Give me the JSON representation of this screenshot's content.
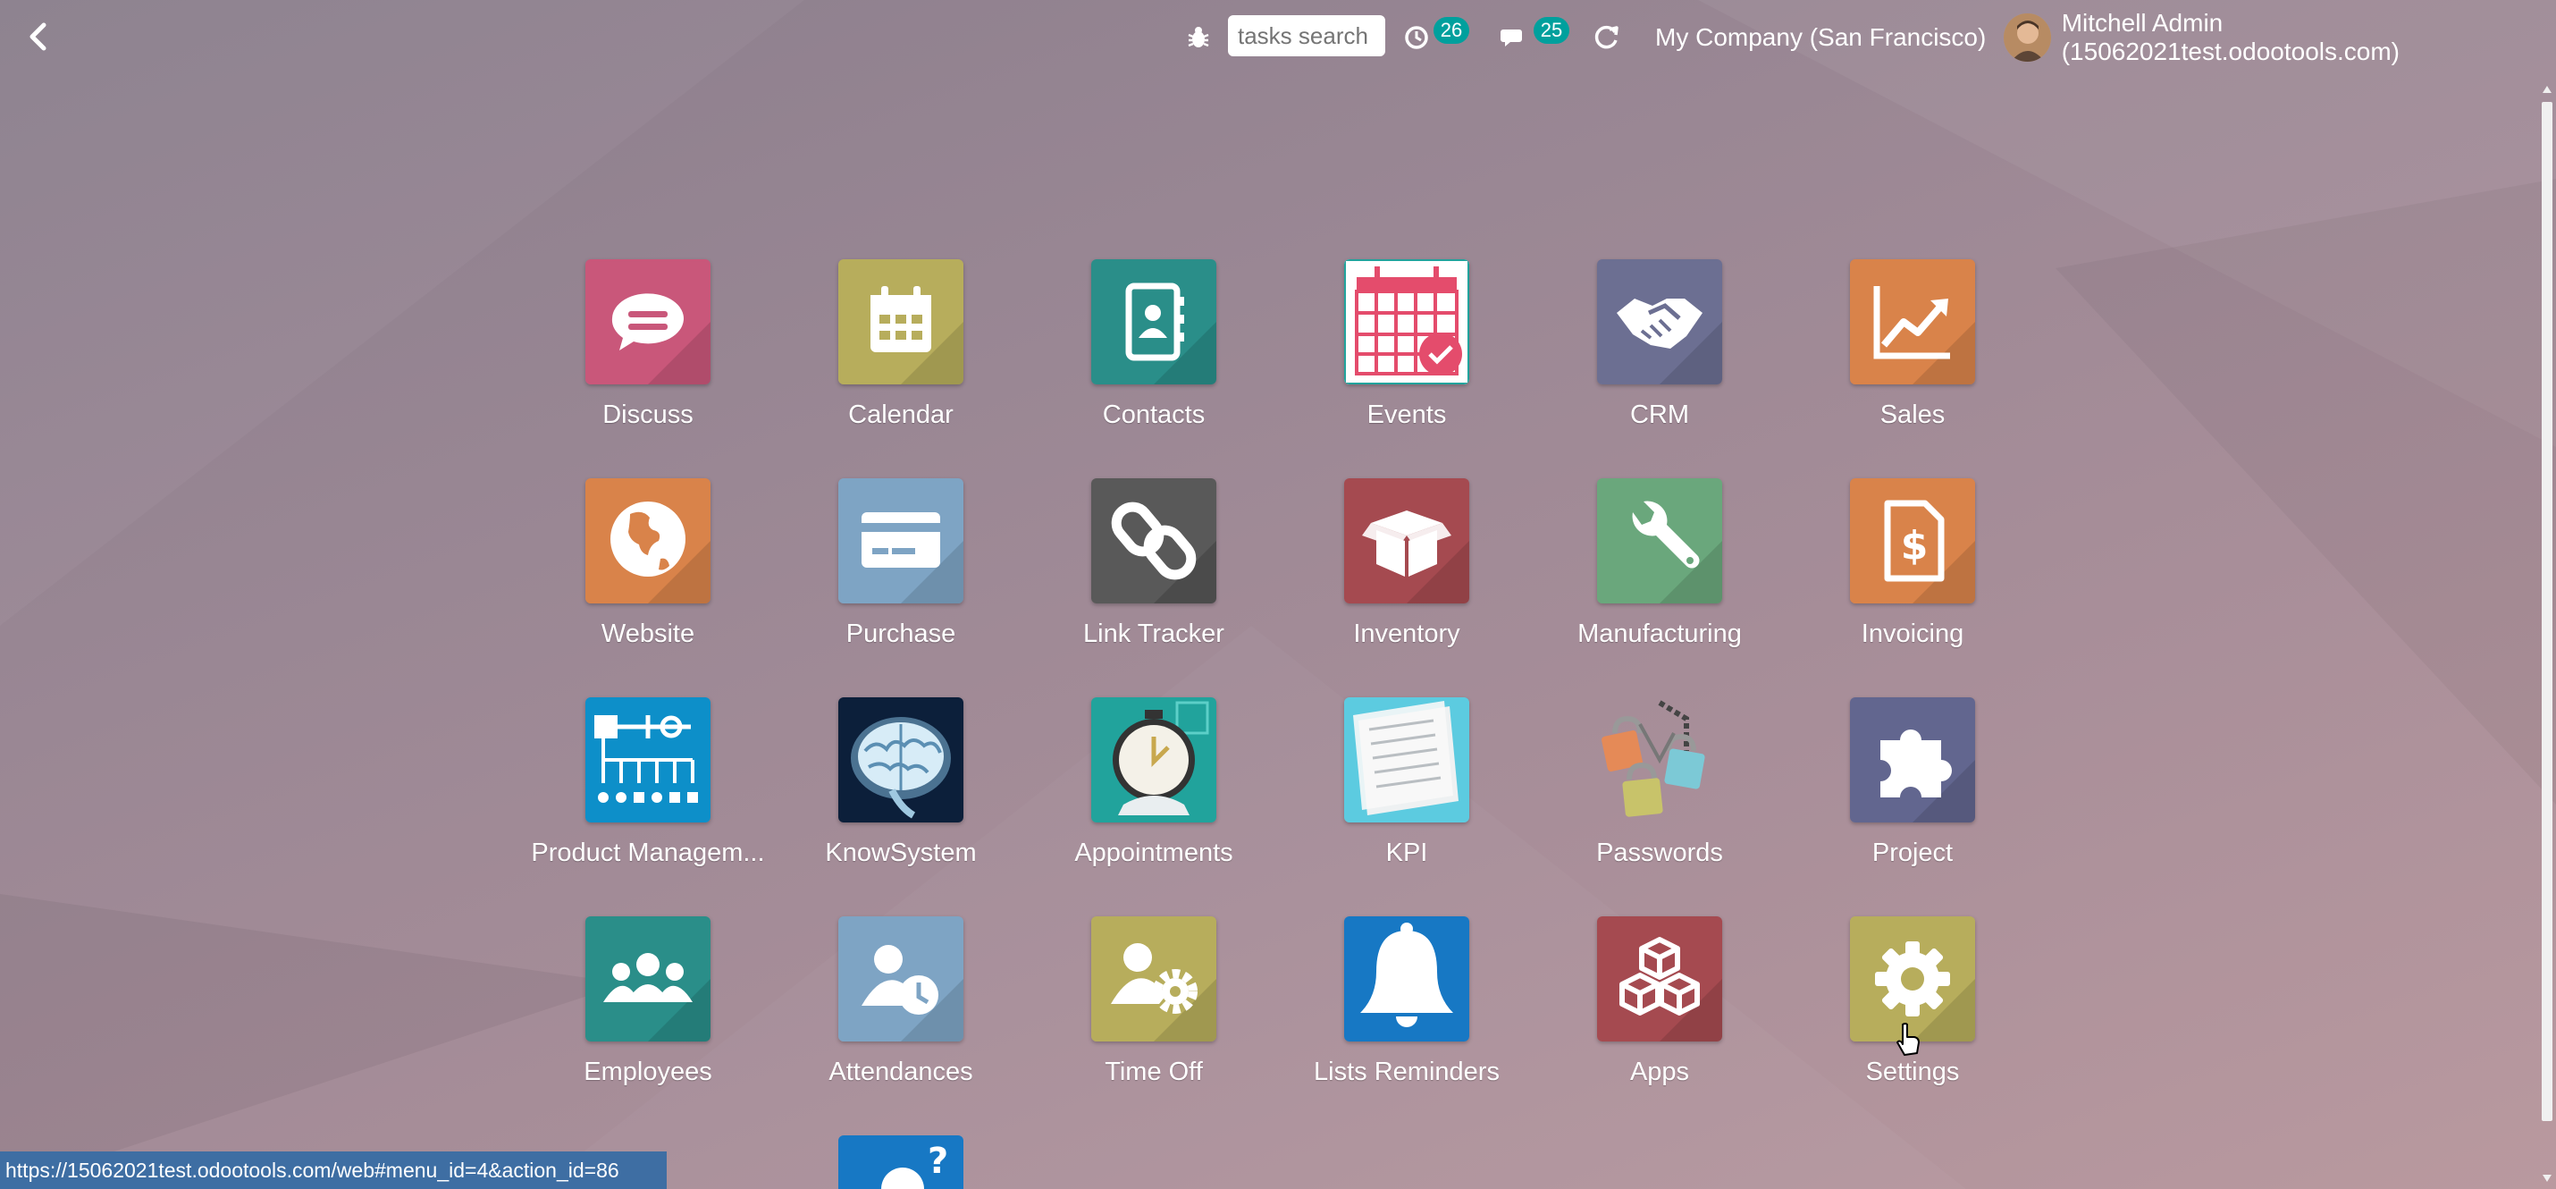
{
  "topbar": {
    "search_placeholder": "tasks search",
    "activity_count": "26",
    "message_count": "25",
    "company": "My Company (San Francisco)",
    "user": "Mitchell Admin (15062021test.odootools.com)"
  },
  "apps": [
    {
      "label": "Discuss",
      "icon": "discuss-icon",
      "color": "#c9577a"
    },
    {
      "label": "Calendar",
      "icon": "calendar-icon",
      "color": "#b7ad5c"
    },
    {
      "label": "Contacts",
      "icon": "contacts-icon",
      "color": "#2a8e89"
    },
    {
      "label": "Events",
      "icon": "events-icon",
      "color": "#ffffff"
    },
    {
      "label": "CRM",
      "icon": "handshake-icon",
      "color": "#6c6f92"
    },
    {
      "label": "Sales",
      "icon": "sales-chart-icon",
      "color": "#d9834a"
    },
    {
      "label": "Website",
      "icon": "globe-icon",
      "color": "#d9834a"
    },
    {
      "label": "Purchase",
      "icon": "credit-card-icon",
      "color": "#7ea4c4"
    },
    {
      "label": "Link Tracker",
      "icon": "link-icon",
      "color": "#595959"
    },
    {
      "label": "Inventory",
      "icon": "box-icon",
      "color": "#a54a50"
    },
    {
      "label": "Manufacturing",
      "icon": "wrench-icon",
      "color": "#6aa77c"
    },
    {
      "label": "Invoicing",
      "icon": "invoice-icon",
      "color": "#d9834a"
    },
    {
      "label": "Product Managem...",
      "icon": "product-tree-icon",
      "color": "#0d8fc9"
    },
    {
      "label": "KnowSystem",
      "icon": "brain-icon",
      "color": "#1b3b66"
    },
    {
      "label": "Appointments",
      "icon": "stopwatch-icon",
      "color": "#21a39c"
    },
    {
      "label": "KPI",
      "icon": "newspaper-icon",
      "color": "#5ccbe0"
    },
    {
      "label": "Passwords",
      "icon": "padlocks-icon",
      "color": "transparent"
    },
    {
      "label": "Project",
      "icon": "puzzle-icon",
      "color": "#62668f"
    },
    {
      "label": "Employees",
      "icon": "employees-icon",
      "color": "#2a8e89"
    },
    {
      "label": "Attendances",
      "icon": "attendance-clock-icon",
      "color": "#7ea4c4"
    },
    {
      "label": "Time Off",
      "icon": "time-off-gear-icon",
      "color": "#b7ad5c"
    },
    {
      "label": "Lists Reminders",
      "icon": "bell-icon",
      "color": "#1778c4"
    },
    {
      "label": "Apps",
      "icon": "cubes-icon",
      "color": "#a54a50"
    },
    {
      "label": "Settings",
      "icon": "gear-icon",
      "color": "#b7ad5c"
    }
  ],
  "status_url": "https://15062021test.odootools.com/web#menu_id=4&action_id=86"
}
